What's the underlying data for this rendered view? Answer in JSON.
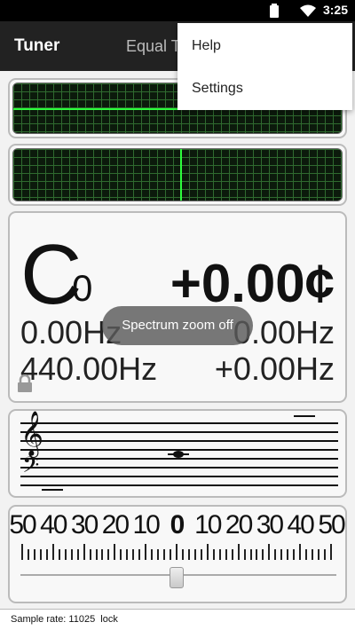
{
  "status_bar": {
    "time": "3:25"
  },
  "app_bar": {
    "title": "Tuner",
    "temperament": "Equal Temperament"
  },
  "menu": {
    "items": [
      "Help",
      "Settings"
    ]
  },
  "tuner": {
    "note": "C",
    "octave": "0",
    "cents": "+0.00¢",
    "reference_hz": "0.00Hz",
    "measured_hz": "0.00Hz",
    "target_hz": "440.00Hz",
    "cents_offset": "+0.00Hz"
  },
  "cents_scale": {
    "labels": [
      "50",
      "40",
      "30",
      "20",
      "10",
      "0",
      "10",
      "20",
      "30",
      "40",
      "50"
    ],
    "needle_value": 0
  },
  "toast": "Spectrum zoom off",
  "footer": {
    "text": "Sample rate: 11025  lock"
  },
  "colors": {
    "scope_bg": "#0c1a0c",
    "scope_grid": "#2f6a2f",
    "trace": "#2cff3c",
    "app_bar": "#222222"
  }
}
